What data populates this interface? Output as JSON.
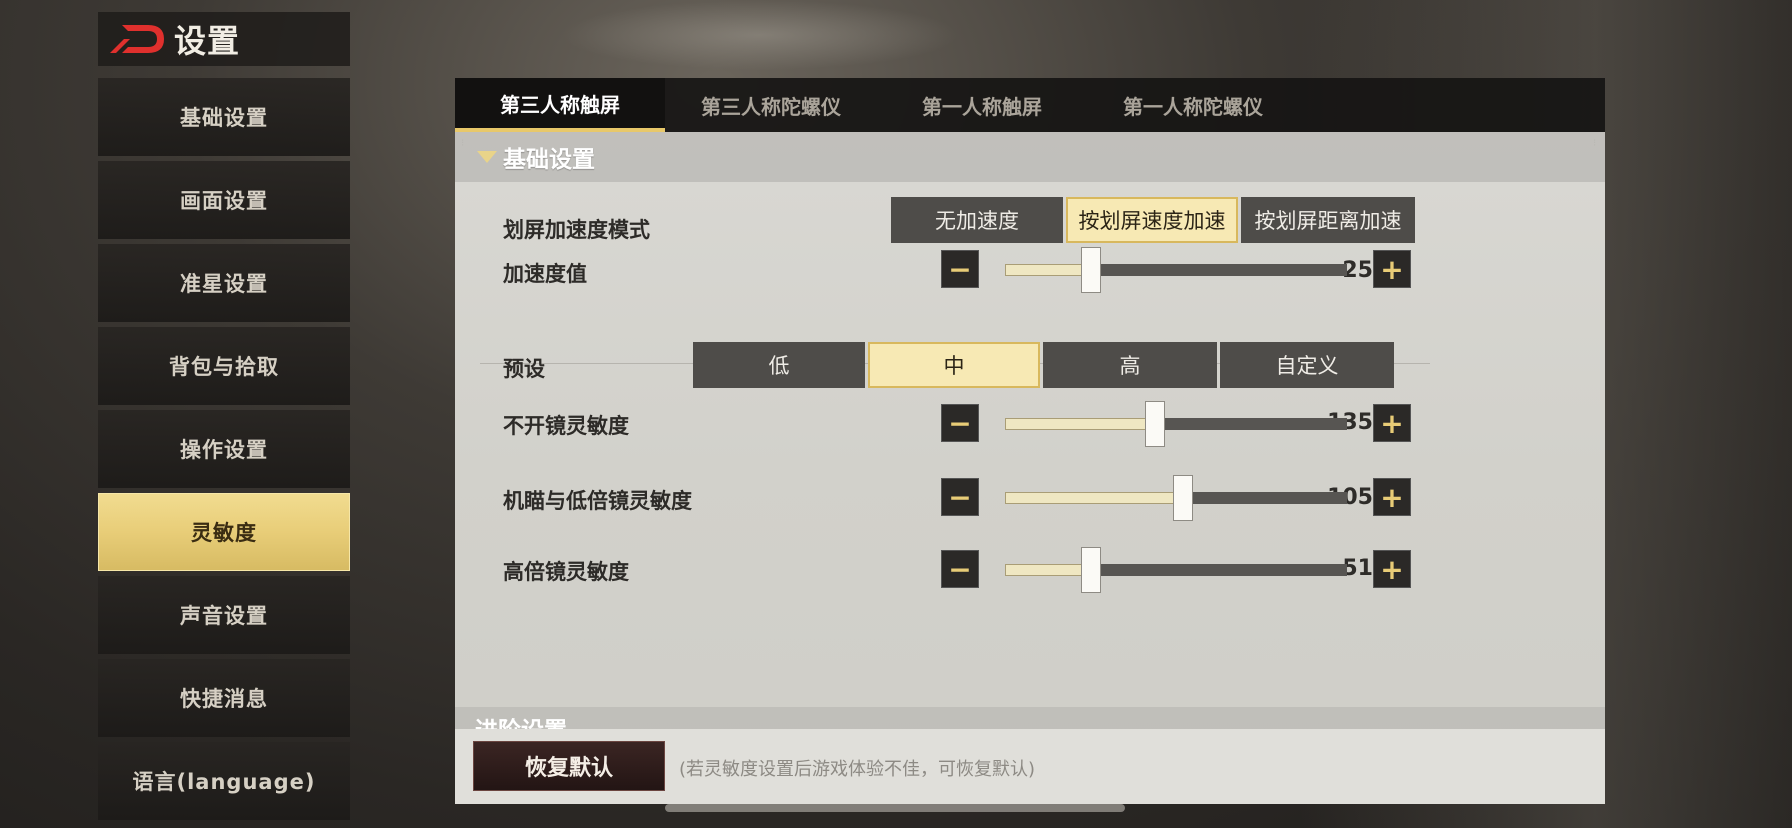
{
  "header": {
    "title": "设置"
  },
  "sidebar": {
    "items": [
      {
        "label": "基础设置"
      },
      {
        "label": "画面设置"
      },
      {
        "label": "准星设置"
      },
      {
        "label": "背包与拾取"
      },
      {
        "label": "操作设置"
      },
      {
        "label": "灵敏度",
        "active": true
      },
      {
        "label": "声音设置"
      },
      {
        "label": "快捷消息"
      },
      {
        "label": "语言(language)"
      }
    ]
  },
  "tabs": [
    {
      "label": "第三人称触屏",
      "active": true
    },
    {
      "label": "第三人称陀螺仪"
    },
    {
      "label": "第一人称触屏"
    },
    {
      "label": "第一人称陀螺仪"
    }
  ],
  "section": {
    "title": "基础设置",
    "accel_mode": {
      "label": "划屏加速度模式",
      "options": [
        "无加速度",
        "按划屏速度加速",
        "按划屏距离加速"
      ],
      "selected": "按划屏速度加速"
    },
    "accel_value": {
      "label": "加速度值",
      "value": "25",
      "fraction": 0.25
    },
    "preset": {
      "label": "预设",
      "options": [
        "低",
        "中",
        "高",
        "自定义"
      ],
      "selected": "中"
    },
    "sliders": [
      {
        "label": "不开镜灵敏度",
        "value": "135",
        "fraction": 0.44
      },
      {
        "label": "机瞄与低倍镜灵敏度",
        "value": "105",
        "fraction": 0.52
      },
      {
        "label": "高倍镜灵敏度",
        "value": "51",
        "fraction": 0.25
      }
    ]
  },
  "next_section": {
    "title": "进阶设置"
  },
  "footer": {
    "reset_label": "恢复默认",
    "note": "(若灵敏度设置后游戏体验不佳，可恢复默认)"
  },
  "stepper": {
    "minus": "−",
    "plus": "+"
  }
}
